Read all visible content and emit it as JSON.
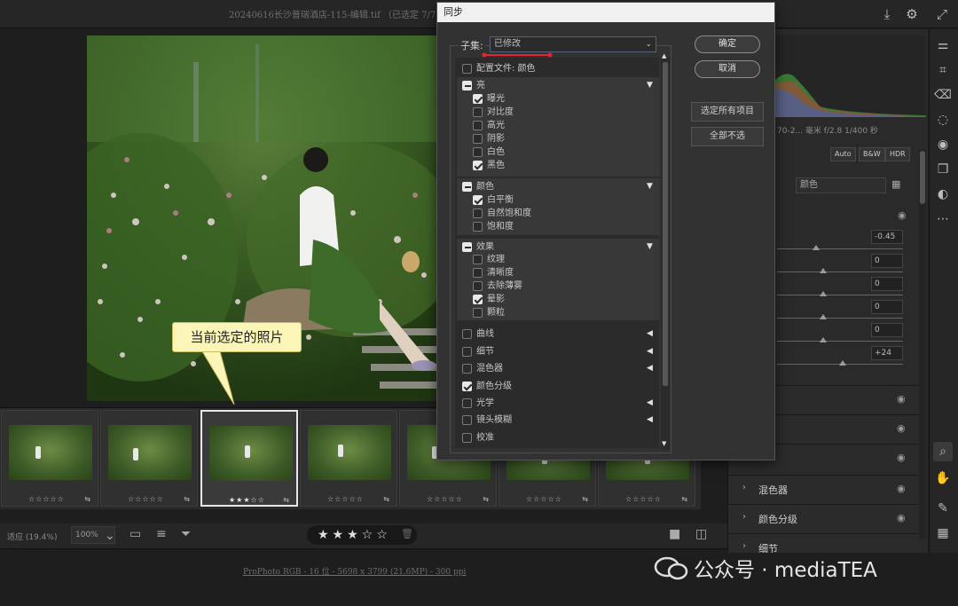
{
  "window": {
    "filename": "20240616长沙普瑞酒店-115-编辑.tif （已选定 7/7）"
  },
  "titlebar_icons": [
    "download-icon",
    "gear-icon",
    "expand-icon"
  ],
  "photo": {
    "callout": "当前选定的照片"
  },
  "filmstrip": {
    "items": [
      {
        "stars": "☆☆☆☆☆",
        "selected": false
      },
      {
        "stars": "☆☆☆☆☆",
        "selected": false
      },
      {
        "stars": "★★★☆☆",
        "selected": true
      },
      {
        "stars": "☆☆☆☆☆",
        "selected": false
      },
      {
        "stars": "☆☆☆☆☆",
        "selected": false
      },
      {
        "stars": "☆☆☆☆☆",
        "selected": false
      },
      {
        "stars": "☆☆☆☆☆",
        "selected": false
      }
    ]
  },
  "bottombar": {
    "fit_label": "适应 (19.4%)",
    "zoom": "100%",
    "rating": "★★★☆☆",
    "rating_value": 3
  },
  "status": {
    "workflow": "ProPhoto RGB - 16 位 - 5698 x 3799 (21.6MP) - 300 ppi"
  },
  "watermark": {
    "text": "公众号 · mediaTEA"
  },
  "rightpanel": {
    "camera_info": "70-2...  毫米      f/2.8    1/400 秒",
    "buttons": [
      "Auto",
      "B&W",
      "HDR"
    ],
    "profile": "颜色",
    "values": [
      "-0.45",
      "0",
      "0",
      "0",
      "0",
      "+24"
    ],
    "sections": [
      "混色器",
      "颜色分级",
      "细节"
    ]
  },
  "dialog": {
    "title": "同步",
    "subset_label": "子集:",
    "subset_value": "已修改",
    "profile_row": "配置文件: 颜色",
    "light": {
      "label": "亮",
      "items": [
        {
          "label": "曝光",
          "checked": true
        },
        {
          "label": "对比度",
          "checked": false
        },
        {
          "label": "高光",
          "checked": false
        },
        {
          "label": "阴影",
          "checked": false
        },
        {
          "label": "白色",
          "checked": false
        },
        {
          "label": "黑色",
          "checked": true
        }
      ]
    },
    "color": {
      "label": "颜色",
      "items": [
        {
          "label": "白平衡",
          "checked": true
        },
        {
          "label": "自然饱和度",
          "checked": false
        },
        {
          "label": "饱和度",
          "checked": false
        }
      ]
    },
    "effects": {
      "label": "效果",
      "items": [
        {
          "label": "纹理",
          "checked": false
        },
        {
          "label": "清晰度",
          "checked": false
        },
        {
          "label": "去除薄雾",
          "checked": false
        },
        {
          "label": "晕影",
          "checked": true
        },
        {
          "label": "颗粒",
          "checked": false
        }
      ]
    },
    "other_items": [
      {
        "label": "曲线",
        "checked": false,
        "arrow": true
      },
      {
        "label": "细节",
        "checked": false,
        "arrow": true
      },
      {
        "label": "混色器",
        "checked": false,
        "arrow": true
      },
      {
        "label": "颜色分级",
        "checked": true,
        "arrow": false
      },
      {
        "label": "光学",
        "checked": false,
        "arrow": true
      },
      {
        "label": "镜头模糊",
        "checked": false,
        "arrow": true
      },
      {
        "label": "校准",
        "checked": false,
        "arrow": false
      }
    ],
    "buttons": {
      "ok": "确定",
      "cancel": "取消",
      "select_all": "选定所有项目",
      "select_none": "全部不选"
    }
  }
}
